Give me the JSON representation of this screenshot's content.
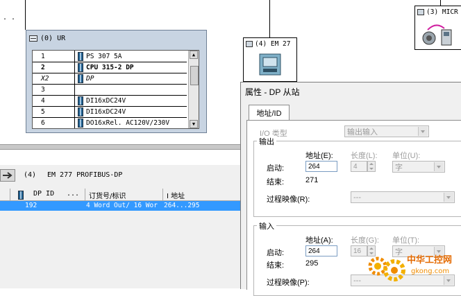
{
  "top_left_text": ". .",
  "rack": {
    "title": "(0) UR",
    "rows": [
      {
        "slot": "1",
        "module": "PS 307 5A",
        "bold": false,
        "italic": false,
        "icon": true
      },
      {
        "slot": "2",
        "module": "CPU 315-2 DP",
        "bold": true,
        "italic": false,
        "icon": true
      },
      {
        "slot": "X2",
        "module": "DP",
        "bold": false,
        "italic": true,
        "icon": true
      },
      {
        "slot": "3",
        "module": "",
        "bold": false,
        "italic": false,
        "icon": false
      },
      {
        "slot": "4",
        "module": "DI16xDC24V",
        "bold": false,
        "italic": false,
        "icon": true
      },
      {
        "slot": "5",
        "module": "DI16xDC24V",
        "bold": false,
        "italic": false,
        "icon": true
      },
      {
        "slot": "6",
        "module": "DO16xRel. AC120V/230V",
        "bold": false,
        "italic": false,
        "icon": true
      }
    ]
  },
  "node_em": {
    "title": "(4) EM 27"
  },
  "node_micro": {
    "title": "(3) MICR"
  },
  "detail": {
    "nav_label": "(4)",
    "station": "EM 277 PROFIBUS-DP",
    "columns": {
      "dp_id": "DP ID",
      "dots": "...",
      "order_no": "订货号/标识",
      "i_address": "I 地址"
    },
    "row": {
      "dp_id": "192",
      "order_no": "4 Word Out/ 16 Wor",
      "i_address": "264...295"
    }
  },
  "dialog": {
    "title": "属性 - DP 从站",
    "tab": "地址/ID",
    "io_type_label": "I/O 类型",
    "io_type_value": "输出输入",
    "output": {
      "group": "输出",
      "address_label": "地址(E):",
      "length_label": "长度(L):",
      "unit_label": "单位(U):",
      "start_label": "启动:",
      "start_value": "264",
      "length_value": "4",
      "unit_value": "字",
      "end_label": "结束:",
      "end_value": "271",
      "process_image_label": "过程映像(R):",
      "process_image_value": "---"
    },
    "input": {
      "group": "输入",
      "address_label": "地址(A):",
      "length_label": "长度(G):",
      "unit_label": "单位(T):",
      "start_label": "启动:",
      "start_value": "264",
      "length_value": "16",
      "unit_value": "字",
      "end_label": "结束:",
      "end_value": "295",
      "process_image_label": "过程映像(P):",
      "process_image_value": "---"
    }
  },
  "watermark": {
    "text": "中华工控网",
    "url": "gkong.com"
  },
  "colors": {
    "rack_bg": "#c8d4e2",
    "selection": "#3399ff",
    "dialog_bg": "#f0f0f0",
    "watermark_orange": "#f08c00"
  }
}
